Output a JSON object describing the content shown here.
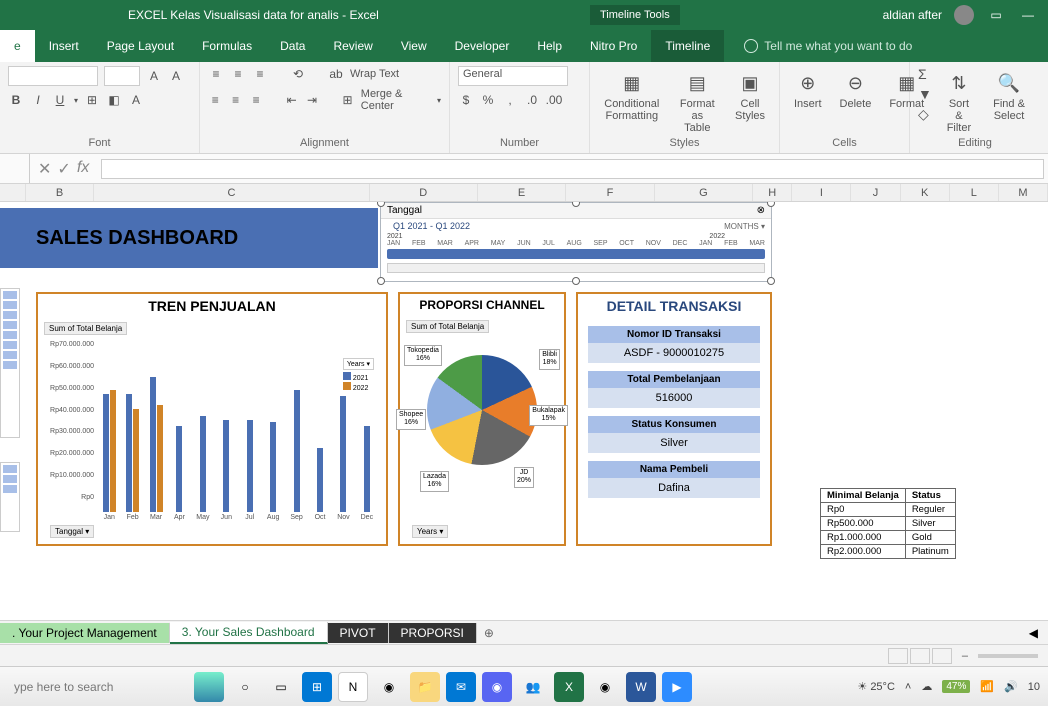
{
  "titlebar": {
    "title": "EXCEL  Kelas Visualisasi data for analis  -  Excel",
    "tool_tab": "Timeline Tools",
    "user": "aldian after"
  },
  "ribbon_tabs": {
    "home": "e",
    "insert": "Insert",
    "page_layout": "Page Layout",
    "formulas": "Formulas",
    "data": "Data",
    "review": "Review",
    "view": "View",
    "developer": "Developer",
    "help": "Help",
    "nitro": "Nitro Pro",
    "timeline": "Timeline",
    "tell_me": "Tell me what you want to do"
  },
  "ribbon": {
    "wrap": "Wrap Text",
    "merge": "Merge & Center",
    "numfmt": "General",
    "cond": "Conditional Formatting",
    "fmt_table": "Format as Table",
    "cell_styles": "Cell Styles",
    "insert": "Insert",
    "delete": "Delete",
    "format": "Format",
    "sort": "Sort & Filter",
    "find": "Find & Select",
    "grp_font": "Font",
    "grp_align": "Alignment",
    "grp_number": "Number",
    "grp_styles": "Styles",
    "grp_cells": "Cells",
    "grp_editing": "Editing"
  },
  "formula": {
    "fx": "fx"
  },
  "columns": [
    "B",
    "C",
    "D",
    "E",
    "F",
    "G",
    "H",
    "I",
    "J",
    "K",
    "L",
    "M"
  ],
  "dashboard": {
    "title": "SALES DASHBOARD"
  },
  "timeline": {
    "label": "Tanggal",
    "period": "MONTHS",
    "range": "Q1 2021 - Q1 2022",
    "yr1": "2021",
    "yr2": "2022",
    "months": [
      "JAN",
      "FEB",
      "MAR",
      "APR",
      "MAY",
      "JUN",
      "JUL",
      "AUG",
      "SEP",
      "OCT",
      "NOV",
      "DEC",
      "JAN",
      "FEB",
      "MAR"
    ]
  },
  "bar_panel": {
    "title": "TREN PENJUALAN",
    "sub": "Sum of Total Belanja",
    "tanggal": "Tanggal",
    "legend_title": "Years",
    "y21": "2021",
    "y22": "2022"
  },
  "chart_data": [
    {
      "type": "bar",
      "title": "TREN PENJUALAN",
      "ylabel": "Sum of Total Belanja",
      "categories": [
        "Jan",
        "Feb",
        "Mar",
        "Apr",
        "May",
        "Jun",
        "Jul",
        "Aug",
        "Sep",
        "Oct",
        "Nov",
        "Dec"
      ],
      "series": [
        {
          "name": "2021",
          "values": [
            55000000,
            55000000,
            63000000,
            40000000,
            45000000,
            43000000,
            43000000,
            42000000,
            57000000,
            30000000,
            55000000,
            40000000
          ]
        },
        {
          "name": "2022",
          "values": [
            57000000,
            48000000,
            50000000,
            null,
            null,
            null,
            null,
            null,
            null,
            null,
            null,
            null
          ]
        }
      ],
      "ylim": [
        0,
        70000000
      ],
      "yticks": [
        "Rp0",
        "Rp10.000.000",
        "Rp20.000.000",
        "Rp30.000.000",
        "Rp40.000.000",
        "Rp50.000.000",
        "Rp60.000.000",
        "Rp70.000.000"
      ]
    },
    {
      "type": "pie",
      "title": "PROPORSI CHANNEL",
      "sub": "Sum of Total Belanja",
      "categories": [
        "Blibli",
        "Bukalapak",
        "JD",
        "Lazada",
        "Shopee",
        "Tokopedia"
      ],
      "values": [
        18,
        15,
        20,
        16,
        16,
        16
      ],
      "legend_title": "Years"
    }
  ],
  "pie_panel": {
    "title": "PROPORSI CHANNEL",
    "sub": "Sum of Total Belanja",
    "years": "Years",
    "labels": {
      "tokopedia": "Tokopedia\n16%",
      "blibli": "Blibli\n18%",
      "bukalapak": "Bukalapak\n15%",
      "jd": "JD\n20%",
      "lazada": "Lazada\n16%",
      "shopee": "Shopee\n16%"
    }
  },
  "detail": {
    "title": "DETAIL TRANSAKSI",
    "id_label": "Nomor ID Transaksi",
    "id_val": "ASDF - 9000010275",
    "total_label": "Total Pembelanjaan",
    "total_val": "516000",
    "status_label": "Status Konsumen",
    "status_val": "Silver",
    "name_label": "Nama Pembeli",
    "name_val": "Dafina"
  },
  "min_table": {
    "h1": "Minimal Belanja",
    "h2": "Status",
    "rows": [
      {
        "a": "Rp0",
        "b": "Reguler"
      },
      {
        "a": "Rp500.000",
        "b": "Silver"
      },
      {
        "a": "Rp1.000.000",
        "b": "Gold"
      },
      {
        "a": "Rp2.000.000",
        "b": "Platinum"
      }
    ]
  },
  "sheet_tabs": {
    "t1": ". Your Project Management",
    "t2": "3. Your Sales Dashboard",
    "t3": "PIVOT",
    "t4": "PROPORSI"
  },
  "taskbar": {
    "search": "ype here to search",
    "temp": "25°C",
    "battery": "47%",
    "time": "10"
  }
}
